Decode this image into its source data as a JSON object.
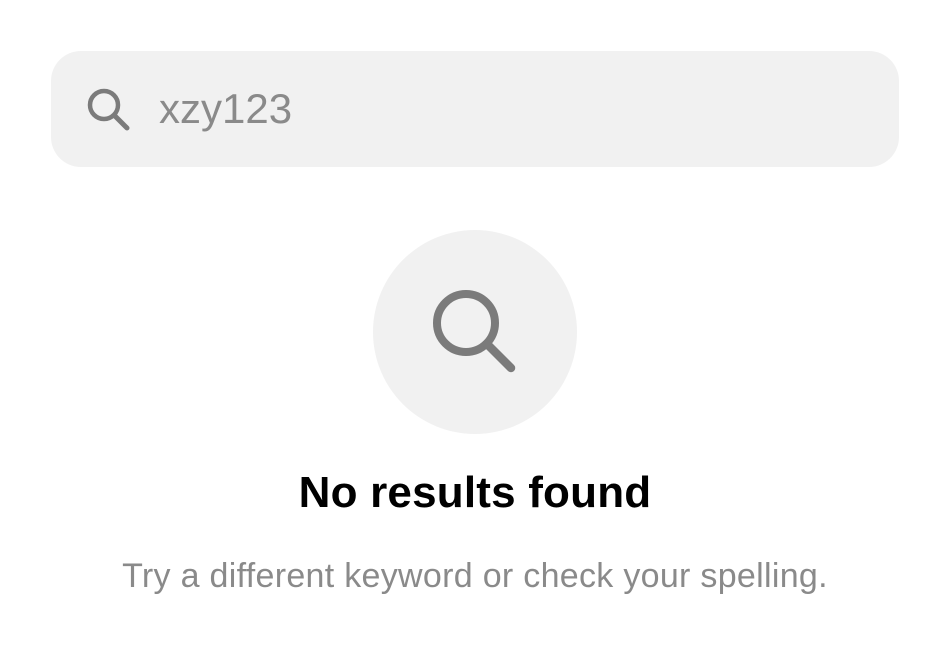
{
  "search": {
    "value": "xzy123",
    "icon": "search-icon"
  },
  "empty_state": {
    "icon": "search-icon",
    "title": "No results found",
    "message": "Try a different keyword or check your spelling."
  },
  "colors": {
    "field_background": "#f1f1f1",
    "muted_text": "#8a8a8a",
    "icon_gray": "#7b7b7b",
    "title_text": "#000000"
  }
}
